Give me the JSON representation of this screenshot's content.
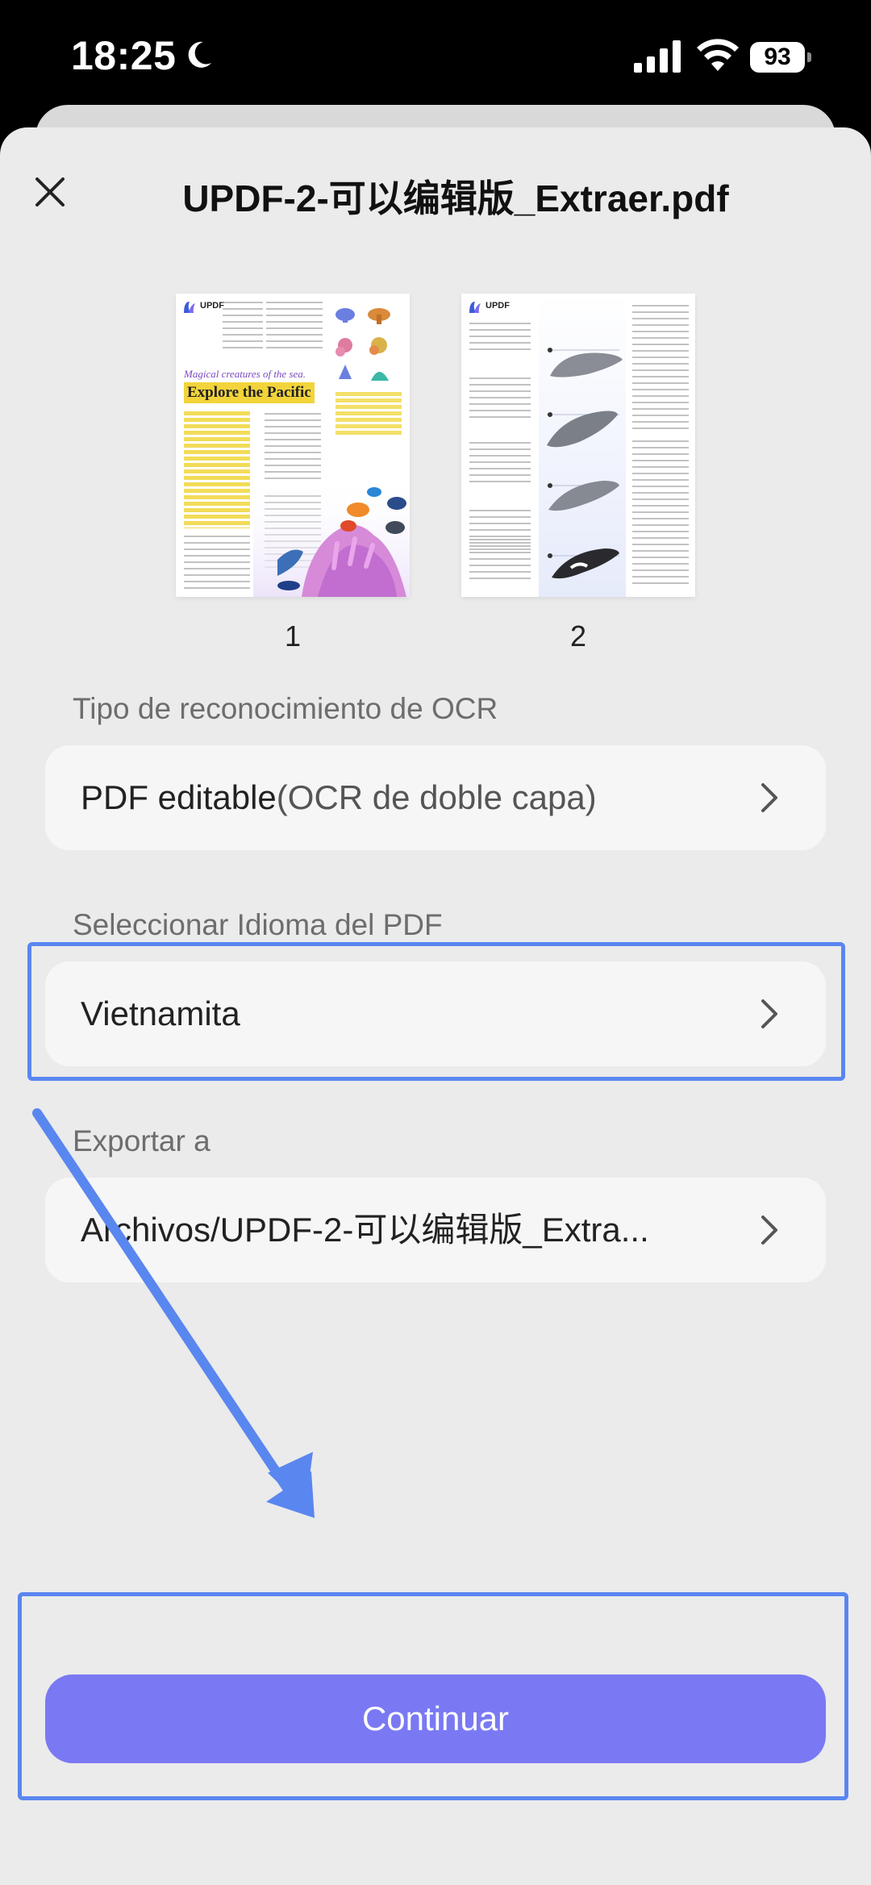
{
  "status_bar": {
    "time": "18:25",
    "battery": "93"
  },
  "header": {
    "title": "UPDF-2-可以编辑版_Extraer.pdf"
  },
  "thumbnails": [
    {
      "page": "1",
      "logo": "UPDF",
      "subtitle": "Magical creatures of the sea.",
      "headline": "Explore the Pacific"
    },
    {
      "page": "2",
      "logo": "UPDF"
    }
  ],
  "ocr_type": {
    "label": "Tipo de reconocimiento de OCR",
    "value_main": "PDF editable",
    "value_detail": "(OCR de doble capa)"
  },
  "language": {
    "label": "Seleccionar Idioma del PDF",
    "value": "Vietnamita"
  },
  "export": {
    "label": "Exportar a",
    "value": "Archivos/UPDF-2-可以编辑版_Extra..."
  },
  "actions": {
    "continue_label": "Continuar"
  },
  "colors": {
    "accent": "#7a79f3",
    "highlight": "#5a86f0",
    "sheet_bg": "#ebebeb",
    "row_bg": "#f6f6f6"
  }
}
